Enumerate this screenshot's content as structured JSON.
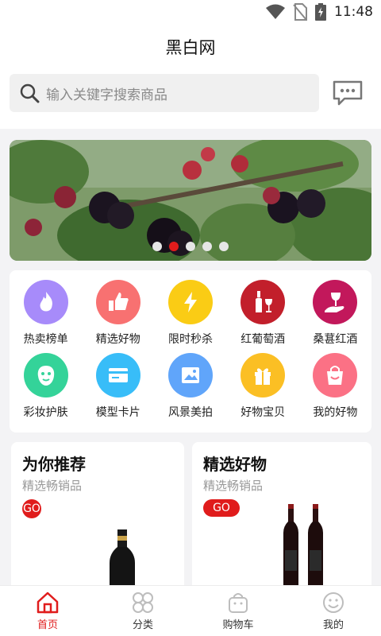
{
  "status_bar": {
    "time": "11:48",
    "icons": [
      "wifi-icon",
      "no-sim-icon",
      "battery-charging-icon"
    ]
  },
  "header": {
    "title": "黑白网"
  },
  "search": {
    "placeholder": "输入关键字搜索商品",
    "icon": "search-icon"
  },
  "message_icon": "message-icon",
  "banner": {
    "slide_count": 5,
    "active_index": 1
  },
  "categories": [
    {
      "label": "热卖榜单",
      "icon": "flame-icon",
      "color": "#a78bfa"
    },
    {
      "label": "精选好物",
      "icon": "thumbs-up-icon",
      "color": "#f87171"
    },
    {
      "label": "限时秒杀",
      "icon": "lightning-icon",
      "color": "#facc15"
    },
    {
      "label": "红葡萄酒",
      "icon": "wine-bottle-icon",
      "color": "#c21f2b"
    },
    {
      "label": "桑葚红酒",
      "icon": "wine-glass-hand-icon",
      "color": "#c2185b"
    },
    {
      "label": "彩妆护肤",
      "icon": "face-mask-icon",
      "color": "#34d399"
    },
    {
      "label": "模型卡片",
      "icon": "card-icon",
      "color": "#38bdf8"
    },
    {
      "label": "风景美拍",
      "icon": "photo-icon",
      "color": "#60a5fa"
    },
    {
      "label": "好物宝贝",
      "icon": "gift-icon",
      "color": "#fbbf24"
    },
    {
      "label": "我的好物",
      "icon": "shopping-bag-icon",
      "color": "#fb7185"
    }
  ],
  "promos": [
    {
      "title": "为你推荐",
      "subtitle": "精选畅销品",
      "button": "GO"
    },
    {
      "title": "精选好物",
      "subtitle": "精选畅销品",
      "button": "GO"
    }
  ],
  "tabbar": [
    {
      "label": "首页",
      "icon": "home-icon",
      "active": true
    },
    {
      "label": "分类",
      "icon": "category-icon",
      "active": false
    },
    {
      "label": "购物车",
      "icon": "cart-icon",
      "active": false
    },
    {
      "label": "我的",
      "icon": "smile-icon",
      "active": false
    }
  ],
  "colors": {
    "accent": "#e01c1c",
    "inactive_icon": "#bdbdbd"
  }
}
